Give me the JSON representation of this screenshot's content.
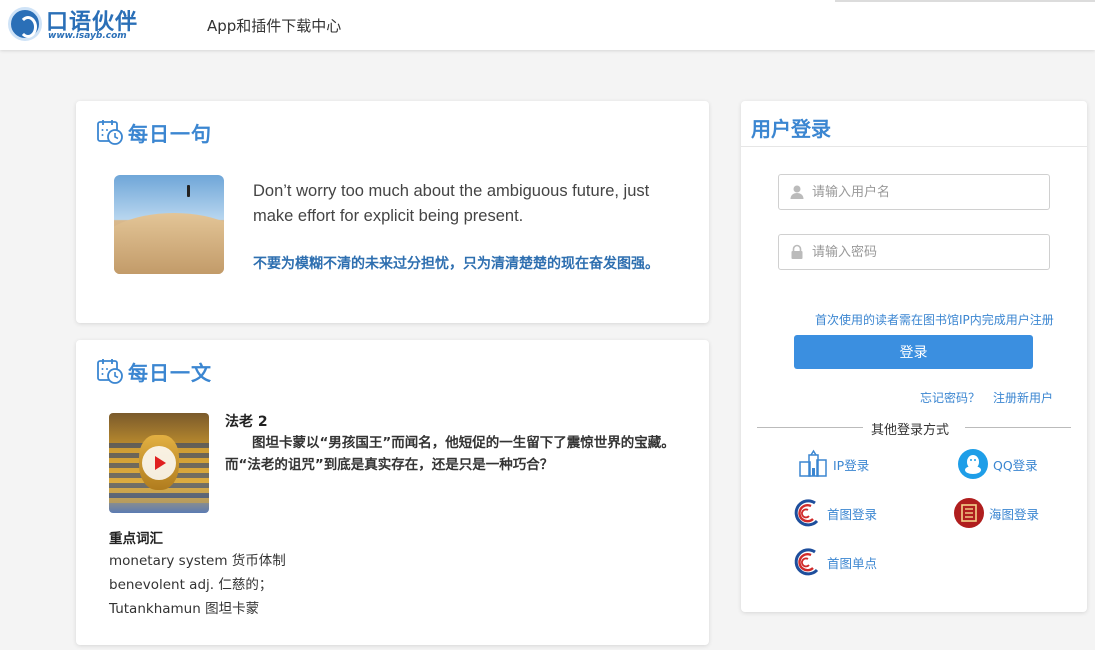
{
  "header": {
    "logo_text": "口语伙伴",
    "logo_sub": "www.isayb.com",
    "nav_download": "App和插件下载中心"
  },
  "daily_sentence": {
    "title": "每日一句",
    "english": "Don’t worry too much about the ambiguous future, just make effort for explicit being present.",
    "chinese": "不要为模糊不清的未来过分担忧，只为清清楚楚的现在奋发图强。"
  },
  "daily_article": {
    "title": "每日一文",
    "article_title": "法老 2",
    "summary": "图坦卡蒙以“男孩国王”而闻名，他短促的一生留下了震惊世界的宝藏。而“法老的诅咒”到底是真实存在，还是只是一种巧合？",
    "vocab_heading": "重点词汇",
    "vocab": [
      "monetary system   货币体制",
      "benevolent  adj.  仁慈的；",
      "Tutankhamun   图坦卡蒙"
    ]
  },
  "login": {
    "title": "用户登录",
    "username_placeholder": "请输入用户名",
    "password_placeholder": "请输入密码",
    "register_hint": "首次使用的读者需在图书馆IP内完成用户注册",
    "submit_label": "登录",
    "forgot_label": "忘记密码？",
    "register_label": "注册新用户",
    "other_methods_label": "其他登录方式",
    "methods": [
      {
        "label": "IP登录",
        "icon": "building-icon"
      },
      {
        "label": "QQ登录",
        "icon": "qq-icon"
      },
      {
        "label": "首图登录",
        "icon": "capital-library-icon"
      },
      {
        "label": "海图登录",
        "icon": "haidian-library-icon"
      },
      {
        "label": "首图单点",
        "icon": "capital-library-sso-icon"
      }
    ]
  },
  "colors": {
    "accent": "#3b86d1",
    "button": "#3b8fe0",
    "qq": "#1e9ee8",
    "haitu": "#b01e1e"
  }
}
